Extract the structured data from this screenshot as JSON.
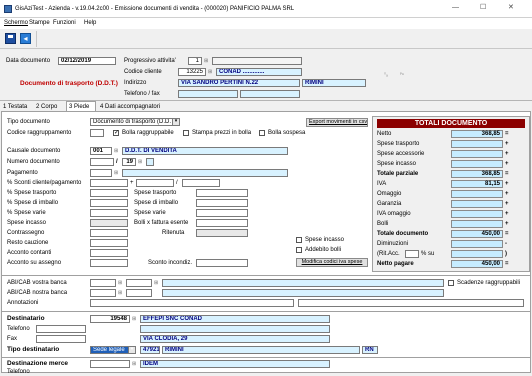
{
  "window": {
    "title": "GisAziTest - Azienda - v.19.04.2c00 - Emissione documenti di vendita - (000020) PANIFICIO PALMA SRL",
    "minimize": "—",
    "maximize": "☐",
    "close": "✕"
  },
  "menu": [
    "Schermo",
    "Stampe",
    "Funzioni",
    "Help"
  ],
  "header": {
    "data_documento_label": "Data documento",
    "data_documento": "02/12/2019",
    "progressivo_label": "Progressivo attivita'",
    "progressivo": "1",
    "codice_cliente_label": "Codice cliente",
    "codice_cliente": "13225",
    "cliente_nome": "CONAD .............",
    "doc_type": "Documento di trasporto (D.D.T.)",
    "indirizzo_label": "Indirizzo",
    "indirizzo": "VIA SANDRO PERTINI N.22",
    "citta": "RIMINI",
    "telefono_label": "Telefono / fax"
  },
  "tabs": [
    "1 Testata",
    "2 Corpo",
    "3 Piede",
    "4 Dati accompagnatori"
  ],
  "piede": {
    "tipo_documento_label": "Tipo documento",
    "tipo_documento": "Documento di trasporto (D.D.T.)",
    "export_button": "Export movimenti in csv",
    "codice_ragg_label": "Codice raggruppamento",
    "bolla_ragg": "Bolla raggruppabile",
    "stampa_prezzi": "Stampa prezzi in bolla",
    "bolla_sospesa": "Bolla sospesa",
    "causale_label": "Causale documento",
    "causale_code": "001",
    "causale_desc": "D.D.T. DI VENDITA",
    "numero_label": "Numero documento",
    "numero_sep": "/",
    "numero": "19",
    "pagamento_label": "Pagamento",
    "sconti_label": "% Sconti cliente/pagamento",
    "sconti_plus": "+",
    "sconti_slash": "/",
    "spese_trasp_pct": "% Spese trasporto",
    "spese_trasp": "Spese trasporto",
    "spese_imb_pct": "% Spese di imballo",
    "spese_imb": "Spese di imballo",
    "spese_varie_pct": "% Spese varie",
    "spese_varie": "Spese varie",
    "spese_incasso": "Spese incasso",
    "bolli_esente": "Bolli x fattura esente",
    "contrassegno": "Contrassegno",
    "ritenuta": "Ritenuta",
    "resto_cauzione": "Resto cauzione",
    "spese_incasso_chk": "Spese incasso",
    "addebito_bolli": "Addebito bolli",
    "acconto_contanti": "Acconto contanti",
    "acconto_assegno": "Acconto su assegno",
    "sconto_incond": "Sconto incondiz.",
    "modifica_iva": "Modifica codici iva spese"
  },
  "totali": {
    "title": "TOTALI DOCUMENTO",
    "rows": [
      {
        "label": "Netto",
        "value": "368,85",
        "sign": "="
      },
      {
        "label": "Spese trasporto",
        "value": "",
        "sign": "+"
      },
      {
        "label": "Spese accessorie",
        "value": "",
        "sign": "+"
      },
      {
        "label": "Spese incasso",
        "value": "",
        "sign": "+"
      },
      {
        "label": "Totale parziale",
        "value": "368,85",
        "sign": "="
      },
      {
        "label": "IVA",
        "value": "81,15",
        "sign": "+"
      },
      {
        "label": "Omaggio",
        "value": "",
        "sign": "+"
      },
      {
        "label": "Garanzia",
        "value": "",
        "sign": "+"
      },
      {
        "label": "IVA omaggio",
        "value": "",
        "sign": "+"
      },
      {
        "label": "Bolli",
        "value": "",
        "sign": "+"
      },
      {
        "label": "Totale documento",
        "value": "450,00",
        "sign": "="
      },
      {
        "label": "Diminuzioni",
        "value": "",
        "sign": "-"
      },
      {
        "label": "(Rit.Acc.",
        "value": "",
        "sign": ")"
      },
      {
        "label": "Netto pagare",
        "value": "450,00",
        "sign": "="
      }
    ],
    "rit_pct_label": "% su"
  },
  "banca": {
    "abi_vostra": "ABI/CAB vostra banca",
    "abi_nostra": "ABI/CAB nostra banca",
    "annotazioni": "Annotazioni",
    "scadenze": "Scadenze raggruppabili"
  },
  "destinatario": {
    "label": "Destinatario",
    "code": "19548",
    "name": "EFFEPI SNC CONAD",
    "telefono": "Telefono",
    "fax": "Fax",
    "via": "VIA CLODIA, 29",
    "tipo_label": "Tipo destinatario",
    "tipo": "Sede legale",
    "cap": "47921",
    "citta": "RIMINI",
    "prov": "RN"
  },
  "merce": {
    "label": "Destinazione merce",
    "name": "IDEM",
    "telefono": "Telefono",
    "fax": "Fax"
  }
}
